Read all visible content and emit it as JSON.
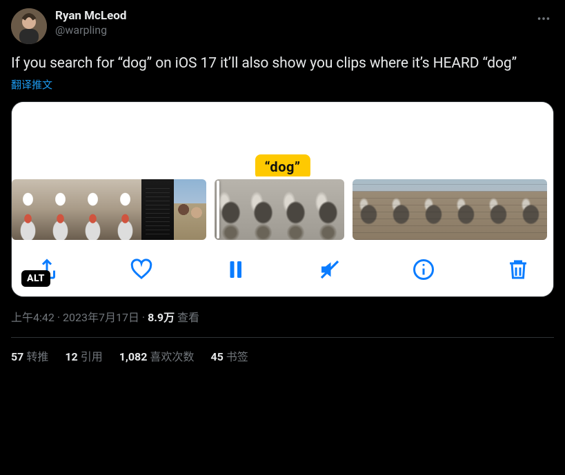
{
  "author": {
    "display_name": "Ryan McLeod",
    "handle": "@warpling"
  },
  "tweet": {
    "text": "If you search for “dog” on iOS 17 it’ll also show you clips where it’s HEARD “dog”",
    "translate_label": "翻译推文"
  },
  "media": {
    "bubble_text": "“dog”",
    "alt_badge": "ALT"
  },
  "meta": {
    "time": "上午4:42",
    "sep1": " · ",
    "date": "2023年7月17日",
    "sep2": " · ",
    "views_count": "8.9万",
    "views_label": " 查看"
  },
  "engagement": {
    "retweets": {
      "count": "57",
      "label": "转推"
    },
    "quotes": {
      "count": "12",
      "label": "引用"
    },
    "likes": {
      "count": "1,082",
      "label": "喜欢次数"
    },
    "bookmarks": {
      "count": "45",
      "label": "书签"
    }
  }
}
